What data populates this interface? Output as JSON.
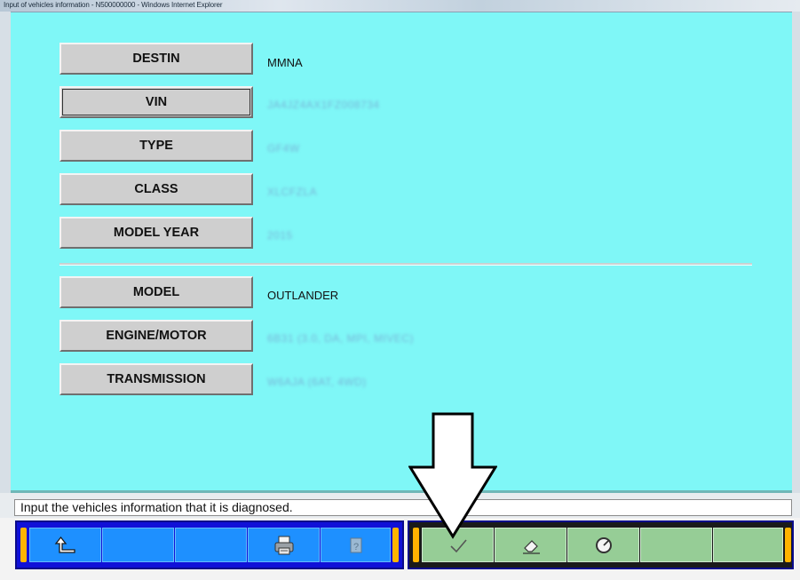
{
  "window": {
    "title": "Input of vehicles information - N500000000 - Windows Internet Explorer"
  },
  "fields": [
    {
      "label": "DESTIN",
      "value": "MMNA",
      "blurred": false
    },
    {
      "label": "VIN",
      "value": "JA4JZ4AX1FZ008734",
      "blurred": true
    },
    {
      "label": "TYPE",
      "value": "GF4W",
      "blurred": true
    },
    {
      "label": "CLASS",
      "value": "XLCFZLA",
      "blurred": true
    },
    {
      "label": "MODEL YEAR",
      "value": "2015",
      "blurred": true
    },
    {
      "label": "MODEL",
      "value": "OUTLANDER",
      "blurred": false
    },
    {
      "label": "ENGINE/MOTOR",
      "value": "6B31 (3.0, DA, MPI, MIVEC)",
      "blurred": true
    },
    {
      "label": "TRANSMISSION",
      "value": "W6AJA (6AT, 4WD)",
      "blurred": true
    }
  ],
  "status_message": "Input the vehicles information that it is diagnosed.",
  "toolbar": {
    "left_buttons": [
      {
        "icon": "return-arrow-icon"
      },
      {
        "icon": "blank"
      },
      {
        "icon": "blank"
      },
      {
        "icon": "printer-icon"
      },
      {
        "icon": "help-icon"
      }
    ],
    "right_buttons": [
      {
        "icon": "checkmark-icon"
      },
      {
        "icon": "eraser-icon"
      },
      {
        "icon": "gauge-icon"
      },
      {
        "icon": "blank"
      },
      {
        "icon": "blank"
      }
    ]
  },
  "colors": {
    "content_bg": "#7ff7f7",
    "blue_group": "#1e90ff",
    "green_group": "#96cd96",
    "grip": "#ffb300"
  }
}
